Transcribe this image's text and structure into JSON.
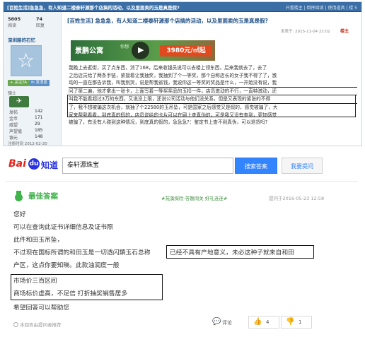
{
  "forum": {
    "title": "[百姓生活]急急急，有人知道二楼泰轩源那个店搞的活动，以及里面卖的玉是真是假?",
    "top_links": "只看楼主 | 倒序阅读 | 使用道具 | 楼 5",
    "user": {
      "views": "5805",
      "views_label": "阅读",
      "replies": "74",
      "replies_label": "回复",
      "name": "深圳路的石忆",
      "avatar_glyph": "☆",
      "follow": "+ 关注TA",
      "message": "✉ 发消息",
      "level": "骑士",
      "badge_glyph": "✈",
      "stats": [
        {
          "k": "发帖",
          "v": "142"
        },
        {
          "k": "金币",
          "v": "171"
        },
        {
          "k": "威望",
          "v": "29"
        },
        {
          "k": "声望值",
          "v": "185"
        },
        {
          "k": "银元",
          "v": "148"
        }
      ],
      "reg_time": "注册时间 2012-02-20"
    },
    "post_title": "[百姓生活] 急急急，有人知道二楼泰轩源那个店搞的活动，以及里面卖的玉是真是假?",
    "post_meta": "发表于: 2015-11-04 22:02",
    "louzhu": "楼主",
    "ad": {
      "brand": "景鹏公寓",
      "sub": "你想",
      "price": "3980元/㎡起",
      "play_glyph": "▶"
    },
    "body": {
      "l1": "我晚上去逛街，买了点东西，消了168，后来收银员说可以去楼上领东西，后来我就去了，去了",
      "l2": "之后店员给了两条手链，紧接着让我抽奖，我抽到了个一等奖，那个自称店长的女子我不得了了，激",
      "l3": "动的一直在那告诉我，叫我别哭，说是帮我省钱，我说你这一等奖的奖品是什么，一开始没有说，我",
      "l4": "问了第二遍，他才拿出一张卡，上面写着一等奖奖品的玉扣一件，店员激动的不行，一直特激动，还",
      "l5": "叫我不能看超过3万的东西，又说没上限，还说公司活动与他们没关系，但是又表现的紧张的不得",
      "l6a": "了，我不想被骗这次机会，就抽了个22580的玉吊坠，可是国家之后感觉又是假的，感觉被骗了，大",
      "l7": "家来帮我看看，到底真的假的，店员说给的卡片可以在网上查真伪的，可是我又没有查到，更加感觉",
      "l8": "被骗了，有没有人碰到这种情况，到底真的假的，急急急?：鉴定书上查不到真伪，可以退货吗?"
    }
  },
  "zhidao": {
    "logo_bai": "Bai",
    "logo_paw": "du",
    "logo_zhidao": "知道",
    "search_value": "泰轩源珠宝",
    "search_button": "搜索答案",
    "ask_button": "我要提问",
    "best_title": "最佳答案",
    "tags": "#苑藻探险-答题闯关 好礼连连#",
    "time": "提问于2016-05-23 12:58",
    "answer_lines": [
      "您好",
      "可以在查询此证书详细信息及证书照",
      "此件和田玉吊坠，",
      "不过现在国标所谓的和田玉是一切透闪類玉石总称",
      "已经不具有产地意义，未必这种子就来自和田",
      "产区，这点你要知晓。此款油润度一般",
      "市场价三百区间",
      "商场标价虚高，不足信 打折抽奖销售居多",
      "希望回答可以帮助您"
    ],
    "report": "本回答由提问者推荐",
    "comment_count": "评论",
    "likes": "4",
    "dislikes": "1",
    "comment_glyph": "💬",
    "like_glyph": "👍",
    "dislike_glyph": "👎"
  }
}
